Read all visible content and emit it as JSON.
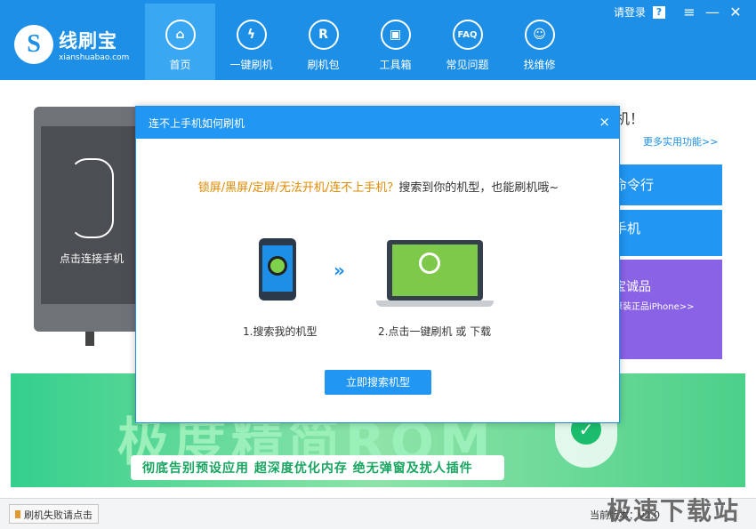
{
  "app": {
    "name": "线刷宝",
    "domain": "xianshuabao.com"
  },
  "window": {
    "login_label": "请登录",
    "help": "?",
    "menu": "≡",
    "minimize": "—",
    "close": "✕"
  },
  "nav": [
    {
      "label": "首页",
      "icon": "home-icon",
      "glyph": "⌂"
    },
    {
      "label": "一键刷机",
      "icon": "lightning-icon",
      "glyph": "ϟ"
    },
    {
      "label": "刷机包",
      "icon": "package-icon",
      "glyph": "R"
    },
    {
      "label": "工具箱",
      "icon": "toolbox-icon",
      "glyph": "▣"
    },
    {
      "label": "常见问题",
      "icon": "faq-icon",
      "glyph": "FAQ"
    },
    {
      "label": "找维修",
      "icon": "repair-person-icon",
      "glyph": "☺"
    }
  ],
  "main": {
    "phone_prompt": "点击连接手机",
    "right_heading_fragment": "机！",
    "more_functions": "更多实用功能>>",
    "cards": [
      "命令行",
      "手机",
      "宝诚品"
    ],
    "card3_sub": "原装正品iPhone>>"
  },
  "banner": {
    "big_text": "极度精简ROM",
    "slogan": "彻底告别预设应用   超深度优化内存   绝无弹窗及扰人插件"
  },
  "dialog": {
    "title": "连不上手机如何刷机",
    "close": "×",
    "warning": "锁屏/黑屏/定屏/无法开机/连不上手机？",
    "message": "搜索到你的机型，也能刷机哦~",
    "step1": "1.搜索我的机型",
    "step2": "2.点击一键刷机 或 下载",
    "button": "立即搜索机型"
  },
  "status": {
    "fail_label": "刷机失败请点击",
    "version": "当前版本：v2.0",
    "watermark": "极速下载站"
  },
  "colors": {
    "primary": "#1d8fe6",
    "warning": "#e08a00",
    "banner_green": "#34cf8c",
    "purple": "#8a62e6"
  }
}
